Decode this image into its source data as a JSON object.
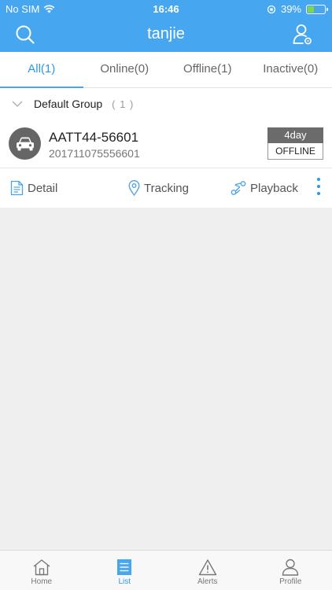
{
  "status_bar": {
    "carrier": "No SIM",
    "time": "16:46",
    "battery": "39%",
    "battery_level": 0.39
  },
  "header": {
    "title": "tanjie",
    "left_icon": "search-icon",
    "right_icon": "user-settings-icon"
  },
  "tabs": [
    {
      "label": "All(1)",
      "active": true
    },
    {
      "label": "Online(0)",
      "active": false
    },
    {
      "label": "Offline(1)",
      "active": false
    },
    {
      "label": "Inactive(0)",
      "active": false
    }
  ],
  "group": {
    "name": "Default Group",
    "count": "( 1 )"
  },
  "device": {
    "name": "AATT44-56601",
    "imei": "201711075556601",
    "duration": "4day",
    "status": "OFFLINE",
    "icon": "car-icon"
  },
  "actions": [
    {
      "label": "Detail",
      "icon": "document-icon"
    },
    {
      "label": "Tracking",
      "icon": "location-pin-icon"
    },
    {
      "label": "Playback",
      "icon": "route-icon"
    }
  ],
  "tabbar": [
    {
      "label": "Home",
      "icon": "home-icon",
      "active": false
    },
    {
      "label": "List",
      "icon": "list-icon",
      "active": true
    },
    {
      "label": "Alerts",
      "icon": "alert-icon",
      "active": false
    },
    {
      "label": "Profile",
      "icon": "profile-icon",
      "active": false
    }
  ],
  "colors": {
    "primary": "#46a7f0",
    "accent": "#2f97e6",
    "background": "#efefef",
    "duration_bg": "#6b6b6b",
    "battery": "#7bd84a"
  }
}
